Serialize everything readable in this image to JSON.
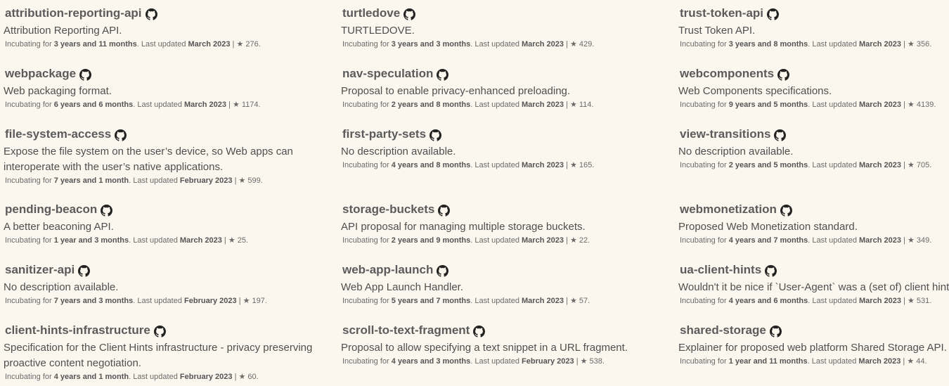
{
  "colors": {
    "background": "#fbf7ef",
    "title": "#5b5b5b",
    "text": "#4f4f4f"
  },
  "labels": {
    "incubating_for": "Incubating for",
    "last_updated": ". Last updated",
    "separator": "|",
    "star_glyph": "★"
  },
  "github_icon": "github-icon",
  "projects": [
    {
      "name": "attribution-reporting-api",
      "description": "Attribution Reporting API.",
      "age": "3 years and 11 months",
      "updated": "March 2023",
      "stars": "276."
    },
    {
      "name": "turtledove",
      "description": "TURTLEDOVE.",
      "age": "3 years and 3 months",
      "updated": "March 2023",
      "stars": "429."
    },
    {
      "name": "trust-token-api",
      "description": "Trust Token API.",
      "age": "3 years and 8 months",
      "updated": "March 2023",
      "stars": "356."
    },
    {
      "name": "webpackage",
      "description": "Web packaging format.",
      "age": "6 years and 6 months",
      "updated": "March 2023",
      "stars": "1174."
    },
    {
      "name": "nav-speculation",
      "description": "Proposal to enable privacy-enhanced preloading.",
      "age": "2 years and 8 months",
      "updated": "March 2023",
      "stars": "114."
    },
    {
      "name": "webcomponents",
      "description": "Web Components specifications.",
      "age": "9 years and 5 months",
      "updated": "March 2023",
      "stars": "4139."
    },
    {
      "name": "file-system-access",
      "description": "Expose the file system on the user’s device, so Web apps can interoperate with the user’s native applications.",
      "age": "7 years and 1 month",
      "updated": "February 2023",
      "stars": "599."
    },
    {
      "name": "first-party-sets",
      "description": "No description available.",
      "age": "4 years and 8 months",
      "updated": "March 2023",
      "stars": "165."
    },
    {
      "name": "view-transitions",
      "description": "No description available.",
      "age": "2 years and 5 months",
      "updated": "March 2023",
      "stars": "705."
    },
    {
      "name": "pending-beacon",
      "description": "A better beaconing API.",
      "age": "1 year and 3 months",
      "updated": "March 2023",
      "stars": "25."
    },
    {
      "name": "storage-buckets",
      "description": "API proposal for managing multiple storage buckets.",
      "age": "2 years and 9 months",
      "updated": "March 2023",
      "stars": "22."
    },
    {
      "name": "webmonetization",
      "description": "Proposed Web Monetization standard.",
      "age": "4 years and 7 months",
      "updated": "March 2023",
      "stars": "349."
    },
    {
      "name": "sanitizer-api",
      "description": "No description available.",
      "age": "7 years and 3 months",
      "updated": "February 2023",
      "stars": "197."
    },
    {
      "name": "web-app-launch",
      "description": "Web App Launch Handler.",
      "age": "5 years and 7 months",
      "updated": "March 2023",
      "stars": "57."
    },
    {
      "name": "ua-client-hints",
      "description": "Wouldn't it be nice if `User-Agent` was a (set of) client hints?",
      "age": "4 years and 6 months",
      "updated": "March 2023",
      "stars": "531."
    },
    {
      "name": "client-hints-infrastructure",
      "description": "Specification for the Client Hints infrastructure - privacy preserving proactive content negotiation.",
      "age": "4 years and 1 month",
      "updated": "February 2023",
      "stars": "60."
    },
    {
      "name": "scroll-to-text-fragment",
      "description": "Proposal to allow specifying a text snippet in a URL fragment.",
      "age": "4 years and 3 months",
      "updated": "February 2023",
      "stars": "538."
    },
    {
      "name": "shared-storage",
      "description": "Explainer for proposed web platform Shared Storage API.",
      "age": "1 year and 11 months",
      "updated": "March 2023",
      "stars": "44."
    }
  ]
}
